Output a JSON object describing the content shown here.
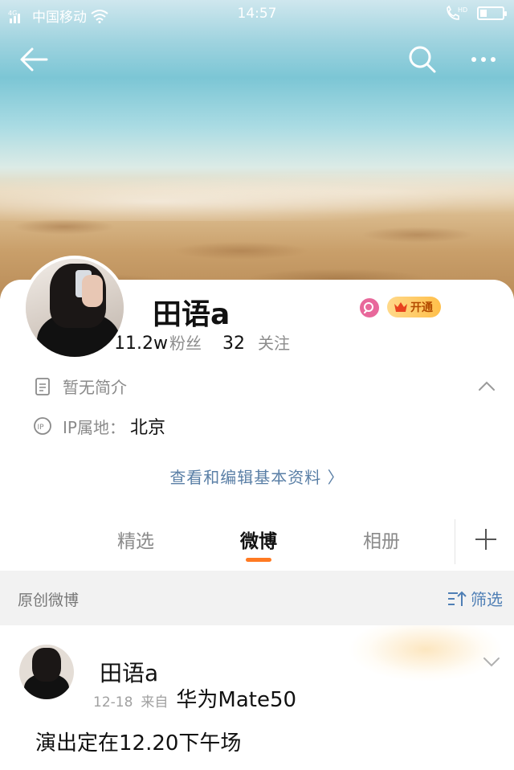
{
  "status_bar": {
    "network": "4G",
    "carrier": "中国移动",
    "time": "14:57",
    "hd": "HD",
    "battery_level": 0.3
  },
  "nav": {
    "back_icon": "arrow-left-icon",
    "search_icon": "search-icon",
    "more_icon": "more-dots-icon"
  },
  "profile": {
    "name": "田语a",
    "followers_count": "11.2w",
    "followers_label": "粉丝",
    "following_count": "32",
    "following_label": "关注",
    "vip_label": "开通",
    "bio": "暂无简介",
    "ip_label": "IP属地：",
    "ip_value": "北京",
    "edit_link": "查看和编辑基本资料 〉"
  },
  "tabs": {
    "items": [
      "精选",
      "微博",
      "相册"
    ],
    "active_index": 1
  },
  "filter": {
    "label": "原创微博",
    "filter_label": "筛选"
  },
  "post": {
    "author": "田语a",
    "date": "12-18",
    "from_label": "来自",
    "device": "华为Mate50",
    "text": "演出定在12.20下午场"
  },
  "colors": {
    "accent_orange": "#ff7a22",
    "link_blue": "#5a7fa6",
    "filter_blue": "#4f7fb5",
    "vip_gold": "#ffbf4a",
    "badge_pink": "#e8689b"
  }
}
